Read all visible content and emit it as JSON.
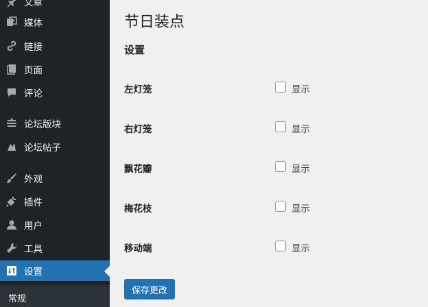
{
  "sidebar": {
    "items": [
      {
        "label": "文章",
        "icon": "pin-icon"
      },
      {
        "label": "媒体",
        "icon": "media-icon"
      },
      {
        "label": "链接",
        "icon": "link-icon"
      },
      {
        "label": "页面",
        "icon": "page-icon"
      },
      {
        "label": "评论",
        "icon": "comment-icon"
      },
      {
        "label": "论坛版块",
        "icon": "forum-icon"
      },
      {
        "label": "论坛帖子",
        "icon": "topic-icon"
      },
      {
        "label": "外观",
        "icon": "brush-icon"
      },
      {
        "label": "插件",
        "icon": "plugin-icon"
      },
      {
        "label": "用户",
        "icon": "user-icon"
      },
      {
        "label": "工具",
        "icon": "wrench-icon"
      },
      {
        "label": "设置",
        "icon": "settings-icon"
      }
    ],
    "submenu": {
      "label": "常规"
    }
  },
  "main": {
    "title": "节日装点",
    "section": "设置",
    "rows": [
      {
        "label": "左灯笼",
        "option": "显示",
        "checked": false
      },
      {
        "label": "右灯笼",
        "option": "显示",
        "checked": false
      },
      {
        "label": "飘花瓣",
        "option": "显示",
        "checked": false
      },
      {
        "label": "梅花枝",
        "option": "显示",
        "checked": false
      },
      {
        "label": "移动端",
        "option": "显示",
        "checked": false
      }
    ],
    "save_label": "保存更改"
  },
  "colors": {
    "sidebar_bg": "#1d2327",
    "accent": "#2271b1",
    "content_bg": "#f0f0f1"
  }
}
